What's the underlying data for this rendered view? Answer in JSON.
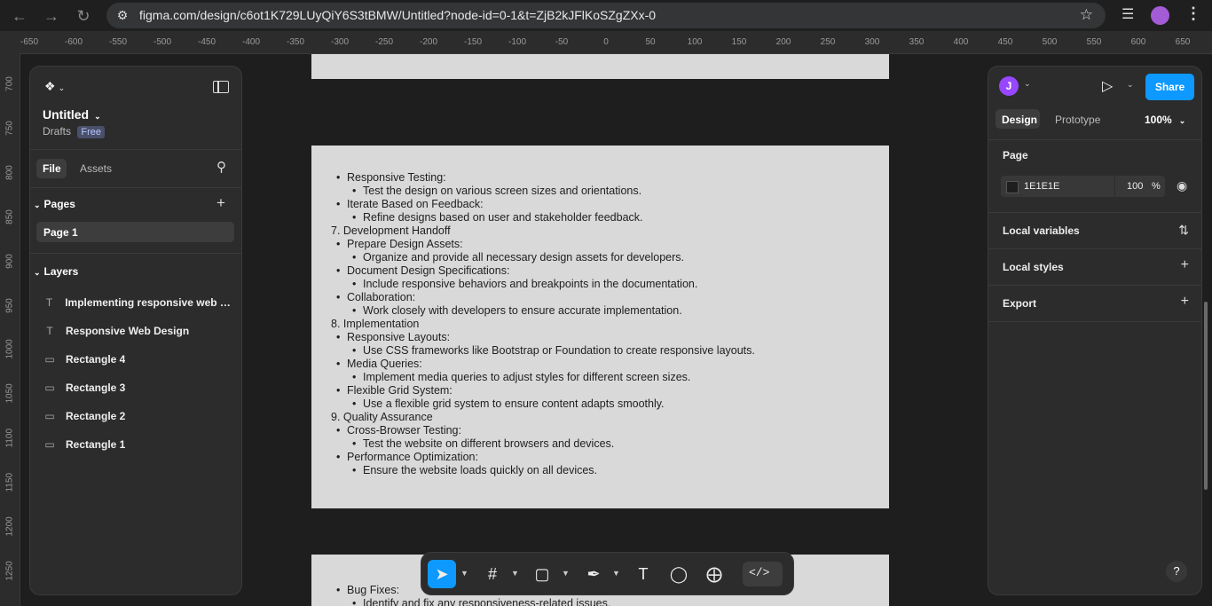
{
  "browser": {
    "url": "figma.com/design/c6ot1K729LUyQiY6S3tBMW/Untitled?node-id=0-1&t=ZjB2kJFlKoSZgZXx-0",
    "back_icon": "arrow-left-icon",
    "forward_icon": "arrow-right-icon",
    "reload_icon": "reload-icon"
  },
  "rulers": {
    "horizontal": [
      "-650",
      "-600",
      "-550",
      "-500",
      "-450",
      "-400",
      "-350",
      "-300",
      "-250",
      "-200",
      "-150",
      "-100",
      "-50",
      "0",
      "50",
      "100",
      "150",
      "200",
      "250",
      "300",
      "350",
      "400",
      "450",
      "500",
      "550",
      "600",
      "650"
    ],
    "vertical": [
      "700",
      "750",
      "800",
      "850",
      "900",
      "950",
      "1000",
      "1050",
      "1100",
      "1150",
      "1200",
      "1250"
    ]
  },
  "left_panel": {
    "file_name": "Untitled",
    "location": "Drafts",
    "plan_badge": "Free",
    "tabs": [
      "File",
      "Assets"
    ],
    "pages_title": "Pages",
    "pages": [
      "Page 1"
    ],
    "layers_title": "Layers",
    "layers": [
      {
        "type": "text",
        "name": "Implementing responsive web des..."
      },
      {
        "type": "text",
        "name": "Responsive Web Design"
      },
      {
        "type": "rect",
        "name": "Rectangle 4"
      },
      {
        "type": "rect",
        "name": "Rectangle 3"
      },
      {
        "type": "rect",
        "name": "Rectangle 2"
      },
      {
        "type": "rect",
        "name": "Rectangle 1"
      }
    ]
  },
  "canvas": {
    "main_text": [
      {
        "level": 1,
        "text": "Responsive Testing:"
      },
      {
        "level": 2,
        "text": "Test the design on various screen sizes and orientations."
      },
      {
        "level": 1,
        "text": "Iterate Based on Feedback:"
      },
      {
        "level": 2,
        "text": "Refine designs based on user and stakeholder feedback."
      },
      {
        "level": 0,
        "text": "7. Development Handoff"
      },
      {
        "level": 1,
        "text": "Prepare Design Assets:"
      },
      {
        "level": 2,
        "text": "Organize and provide all necessary design assets for developers."
      },
      {
        "level": 1,
        "text": "Document Design Specifications:"
      },
      {
        "level": 2,
        "text": "Include responsive behaviors and breakpoints in the documentation."
      },
      {
        "level": 1,
        "text": "Collaboration:"
      },
      {
        "level": 2,
        "text": "Work closely with developers to ensure accurate implementation."
      },
      {
        "level": 0,
        "text": "8. Implementation"
      },
      {
        "level": 1,
        "text": "Responsive Layouts:"
      },
      {
        "level": 2,
        "text": "Use CSS frameworks like Bootstrap or Foundation to create responsive layouts."
      },
      {
        "level": 1,
        "text": "Media Queries:"
      },
      {
        "level": 2,
        "text": "Implement media queries to adjust styles for different screen sizes."
      },
      {
        "level": 1,
        "text": "Flexible Grid System:"
      },
      {
        "level": 2,
        "text": "Use a flexible grid system to ensure content adapts smoothly."
      },
      {
        "level": 0,
        "text": "9. Quality Assurance"
      },
      {
        "level": 1,
        "text": "Cross-Browser Testing:"
      },
      {
        "level": 2,
        "text": "Test the website on different browsers and devices."
      },
      {
        "level": 1,
        "text": "Performance Optimization:"
      },
      {
        "level": 2,
        "text": "Ensure the website loads quickly on all devices."
      }
    ],
    "bottom_text": [
      {
        "level": 1,
        "text": "Bug Fixes:"
      },
      {
        "level": 2,
        "text": "Identify and fix any responsiveness-related issues."
      }
    ]
  },
  "right_panel": {
    "avatar_initial": "J",
    "share_label": "Share",
    "tabs": [
      "Design",
      "Prototype"
    ],
    "zoom": "100%",
    "page_title": "Page",
    "bg_hex": "1E1E1E",
    "bg_opacity": "100",
    "percent_sign": "%",
    "sections": [
      "Local variables",
      "Local styles",
      "Export"
    ]
  },
  "toolbar": {
    "tools": [
      "move-icon",
      "frame-icon",
      "rectangle-icon",
      "pen-icon",
      "text-icon",
      "comment-icon",
      "actions-icon",
      "dev-mode-icon"
    ]
  },
  "colors": {
    "accent": "#0d99ff",
    "canvas_bg": "#1e1e1e",
    "panel_bg": "#2c2c2c",
    "frame_fill": "#d9d9d9"
  }
}
